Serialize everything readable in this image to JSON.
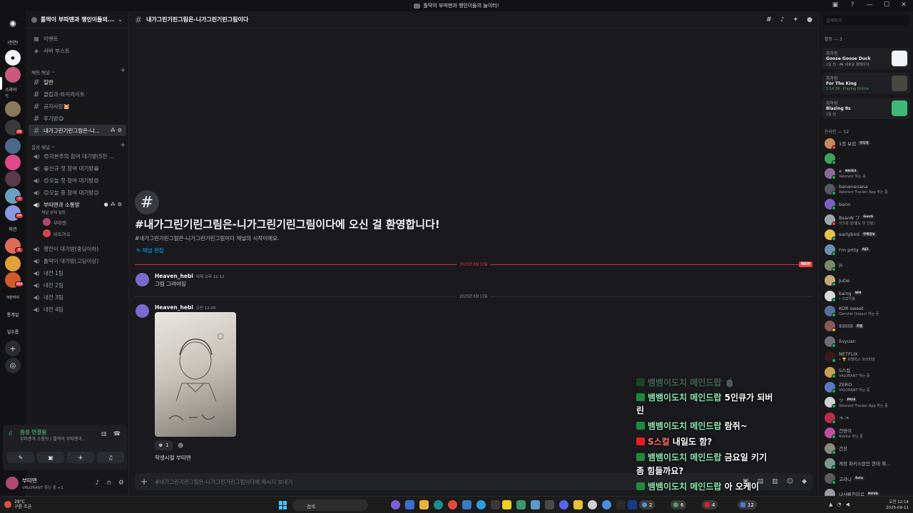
{
  "window": {
    "title": "틀딱이 부따맨과 챙인이들의 놀이터!"
  },
  "server_rail": {
    "labels": [
      "!전연!",
      "트라이드",
      "따연",
      "통계일",
      "일수롭"
    ],
    "badges": [
      "26",
      "4",
      "44",
      "8",
      "484"
    ]
  },
  "sidebar": {
    "guild_name": "틀딱이 부따맨과 챙인이들의...",
    "top_items": [
      {
        "label": "이벤트",
        "icon": "calendar-icon"
      },
      {
        "label": "서버 부스트",
        "icon": "boost-icon"
      }
    ],
    "text_category": "채팅 채널",
    "text_channels": [
      {
        "label": "일반"
      },
      {
        "label": "클립과-하이라이트"
      },
      {
        "label": "공지사항🐹"
      },
      {
        "label": "후기방😋"
      },
      {
        "label": "내가그린기린그림은-니..."
      }
    ],
    "voice_category": "음성 채널",
    "voice_channels": [
      {
        "label": "😍자본주의 참여 대기방(5천 ..."
      },
      {
        "label": "😁신규 첫 참여 대기방😁"
      },
      {
        "label": "😍오늘 첫 참여 대기방😍"
      },
      {
        "label": "😊오늘 중 참여 대기방😊"
      },
      {
        "label": "부따맨과 소통방"
      }
    ],
    "voice_status": "채널 상태 설정",
    "voice_users": [
      "부따맨",
      "비트이오"
    ],
    "more_channels": [
      {
        "label": "챙인이 대기방(중딩이하)"
      },
      {
        "label": "틀딱이 대기방(고딩이상)"
      },
      {
        "label": "내전 1팀"
      },
      {
        "label": "내전 2팀"
      },
      {
        "label": "내전 3팀"
      },
      {
        "label": "내전 4팀"
      }
    ]
  },
  "voice_panel": {
    "title": "음성 연결됨",
    "subtitle": "부따맨과 소통방 / 틀딱이 부따맨과..."
  },
  "user_panel": {
    "name": "부따맨",
    "status": "VALORANT 하는 중 +1"
  },
  "channel": {
    "name": "내가그린기린그림은-니가그린기린그림이다",
    "welcome_title": "#내가그린기린그림은-니가그린기린그림이다에 오신 걸 환영합니다!",
    "welcome_sub": "#내가그린기린그림은-니가그린기린그림이다 채널의 시작이에요.",
    "edit_label": "채널 편집",
    "composer_placeholder": "#내가그린기린그림은-니가그린기린그림이다에 메시지 보내기"
  },
  "messages": {
    "divider1": "2025년 9월 10일",
    "new_tag": "NEW",
    "m1": {
      "author": "Heaven_hebi",
      "time": "어제 오후 11:12",
      "text": "그림 그려야징"
    },
    "divider2": "2025년 9월 11일",
    "m2": {
      "author": "Heaven_hebi",
      "time": "오전 12:00",
      "reaction_count": "1",
      "caption": "학생시절 부따맨"
    }
  },
  "overlay": [
    {
      "nick": "뱀뱀이도치 메인드랍",
      "text": " 🍵"
    },
    {
      "nick": "뱀뱀이도치 메인드랍",
      "text": " 5인큐가 되버"
    },
    {
      "nick": "",
      "text": "린"
    },
    {
      "nick": "뱀뱀이도치 메인드랍",
      "text": " 람쥐~"
    },
    {
      "nick": "S스컬",
      "text": " 내일도 함?"
    },
    {
      "nick": "뱀뱀이도치 메인드랍",
      "text": " 금요일 키기"
    },
    {
      "nick": "",
      "text": "좀 힘들까요?"
    },
    {
      "nick": "뱀뱀이도치 메인드랍",
      "text": " 아 오케이"
    }
  ],
  "members": {
    "search_placeholder": "검색하기",
    "activity_label": "활동 — 3",
    "activities": [
      {
        "who": "최하링",
        "game": "Goose Goose Duck",
        "detail": "1일 전 · 🎮 새로운 플레이어"
      },
      {
        "who": "최하링",
        "game": "For The King",
        "detail": "1:14:39 · Playing Online"
      },
      {
        "who": "최하링",
        "game": "Blazing 8s",
        "detail": "1일 전"
      }
    ],
    "online_label": "온라인 — 52",
    "list": [
      {
        "name": "1정 보검",
        "tag": "무지개",
        "status": "",
        "color": "#c98a5a",
        "dot": "#f23f43"
      },
      {
        "name": "-",
        "tag": "",
        "status": "",
        "color": "#3ba55c",
        "dot": "#23a55a"
      },
      {
        "name": "a",
        "tag": "NHIEX",
        "status": "Valorant 하는 중",
        "color": "#8a6a9a",
        "dot": "#23a55a"
      },
      {
        "name": "banananana",
        "tag": "",
        "status": "Valorant Tracker App 하는 중",
        "color": "#555860",
        "dot": "#23a55a"
      },
      {
        "name": "bann",
        "tag": "",
        "status": "",
        "color": "#7b5fbf",
        "dot": "#23a55a"
      },
      {
        "name": "BsanN フ",
        "tag": "GenG",
        "status": "마크판 형(별도 및 인정)",
        "color": "#a0a4ad",
        "dot": "#f23f43"
      },
      {
        "name": "earlybird",
        "tag": "무혜정보",
        "status": "",
        "color": "#e8c34a",
        "dot": "#23a55a"
      },
      {
        "name": "I'm prtty",
        "tag": "NJZ",
        "status": "",
        "color": "#6a8fb0",
        "dot": "#23a55a"
      },
      {
        "name": "js",
        "tag": "",
        "status": "",
        "color": "#7a8a6a",
        "dot": "#23a55a"
      },
      {
        "name": "JuDe",
        "tag": "",
        "status": "",
        "color": "#c9a97a",
        "dot": "#23a55a"
      },
      {
        "name": "kaing",
        "tag": "WH",
        "status": "• 이모지움",
        "color": "#d9d9d9",
        "dot": "#23a55a"
      },
      {
        "name": "KOR sweet",
        "tag": "",
        "status": "Genshin Impact 하는 중",
        "color": "#5a6fa0",
        "dot": "#23a55a"
      },
      {
        "name": "lllllllllll",
        "tag": "파랭",
        "status": "",
        "color": "#8a5a5a",
        "dot": "#f0b232"
      },
      {
        "name": "liuyuan",
        "tag": "",
        "status": "",
        "color": "#6d6f78",
        "dot": "#23a55a"
      },
      {
        "name": "NETFLIX",
        "tag": "",
        "status": "• 🏆 모헬럭스 프리미엄",
        "color": "#3a1a1a",
        "dot": "#23a55a"
      },
      {
        "name": "S스컬",
        "tag": "",
        "status": "VALORANT 하는 중",
        "color": "#c9a050",
        "dot": "#23a55a"
      },
      {
        "name": "ZERO",
        "tag": "",
        "status": "VALORANT 하는 중",
        "color": "#5a7ac0",
        "dot": "#23a55a"
      },
      {
        "name": "ツ",
        "tag": "PRIX",
        "status": "Valorant Tracker App 하는 중",
        "color": "#d0d0d0",
        "dot": "#23a55a"
      },
      {
        "name": "ㅋ-ㅋ",
        "tag": "",
        "status": "",
        "color": "#c02a4a",
        "dot": "#23a55a"
      },
      {
        "name": "건방이",
        "tag": "",
        "status": "Roblox 하는 중",
        "color": "#c050a0",
        "dot": "#23a55a"
      },
      {
        "name": "건장",
        "tag": "",
        "status": "",
        "color": "#8a8a7a",
        "dot": "#23a55a"
      },
      {
        "name": "게정 파키스탄인 한테 해...",
        "tag": "",
        "status": "",
        "color": "#7a9a8a",
        "dot": "#23a55a"
      },
      {
        "name": "고라니",
        "tag": "Solo",
        "status": "",
        "color": "#5a5a5a",
        "dot": "#23a55a"
      },
      {
        "name": "나사빠진미르",
        "tag": "NOVA",
        "status": "",
        "color": "#9a9aa0",
        "dot": "#23a55a"
      }
    ]
  },
  "taskbar": {
    "weather_temp": "28°C",
    "weather_text": "구름 조금",
    "search_label": "검색",
    "pills": [
      "2",
      "6",
      "4",
      "12"
    ],
    "time": "오전 12:14",
    "date": "2025-09-11"
  }
}
